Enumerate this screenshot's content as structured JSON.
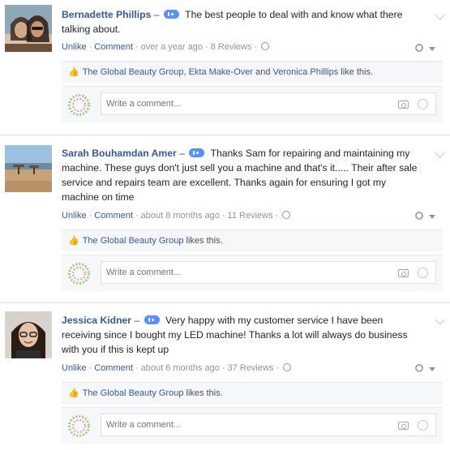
{
  "reviews": [
    {
      "author": "Bernadette Phillips",
      "separator": "–",
      "text": "The best people to deal with and know what there talking about.",
      "actions": {
        "unlike": "Unlike",
        "comment": "Comment",
        "time": "over a year ago",
        "reviews": "8 Reviews",
        "dot": "·"
      },
      "likes": {
        "names_1": "The Global Beauty Group",
        "sep_1": ", ",
        "names_2": "Ekta Make-Over",
        "sep_2": " and ",
        "names_3": "Veronica Phillips",
        "suffix": " like this."
      },
      "comment_placeholder": "Write a comment..."
    },
    {
      "author": "Sarah Bouhamdan Amer",
      "separator": "–",
      "text": "Thanks Sam for repairing and maintaining my machine. These guys don't just sell you a machine and that's it..... Their after sale service and repairs team are excellent. Thanks again for ensuring I got my machine on time",
      "actions": {
        "unlike": "Unlike",
        "comment": "Comment",
        "time": "about 8 months ago",
        "reviews": "11 Reviews",
        "dot": "·"
      },
      "likes": {
        "names_1": "The Global Beauty Group",
        "suffix": " likes this."
      },
      "comment_placeholder": "Write a comment..."
    },
    {
      "author": "Jessica Kidner",
      "separator": "–",
      "text": "Very happy with my customer service I have been receiving since I bought my LED machine! Thanks a lot will always do business with you if this is kept up",
      "actions": {
        "unlike": "Unlike",
        "comment": "Comment",
        "time": "about 6 months ago",
        "reviews": "37 Reviews",
        "dot": "·"
      },
      "likes": {
        "names_1": "The Global Beauty Group",
        "suffix": " likes this."
      },
      "comment_placeholder": "Write a comment..."
    }
  ],
  "colors": {
    "link": "#365899",
    "rating_badge": "#5890ff",
    "panel_bg": "#f6f7f9"
  }
}
